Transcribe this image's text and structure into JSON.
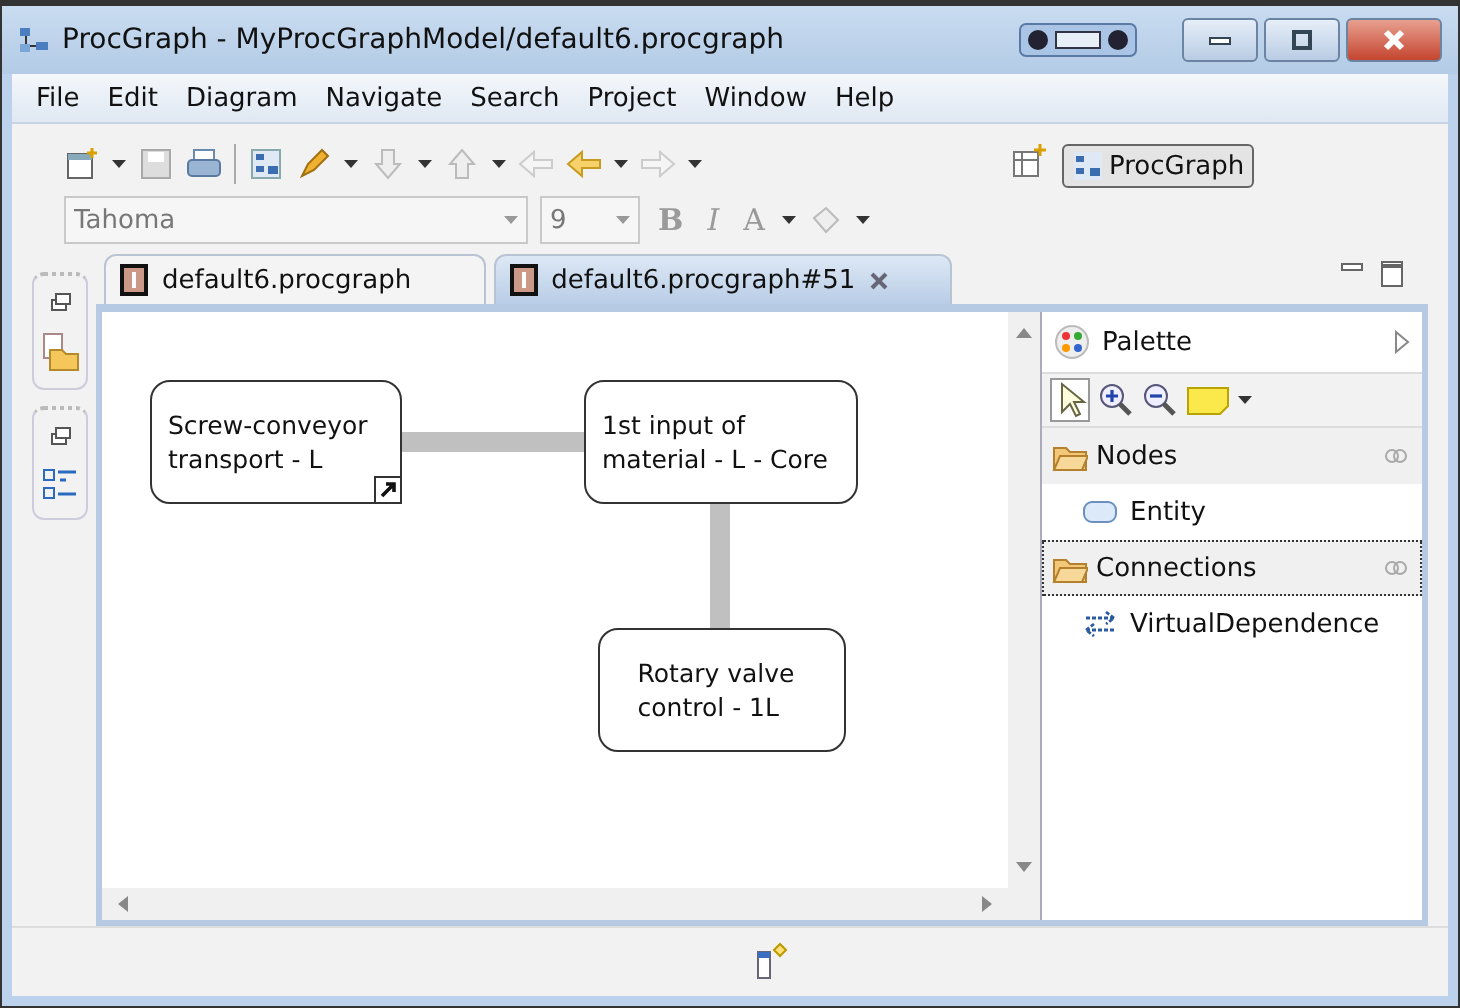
{
  "window": {
    "title": "ProcGraph - MyProcGraphModel/default6.procgraph"
  },
  "menu": [
    {
      "label": "File"
    },
    {
      "label": "Edit"
    },
    {
      "label": "Diagram"
    },
    {
      "label": "Navigate"
    },
    {
      "label": "Search"
    },
    {
      "label": "Project"
    },
    {
      "label": "Window"
    },
    {
      "label": "Help"
    }
  ],
  "toolbar": {
    "font": "Tahoma",
    "size": "9",
    "format_buttons": [
      {
        "label": "B",
        "disabled": true
      },
      {
        "label": "I",
        "disabled": true
      },
      {
        "label": "A",
        "disabled": true
      }
    ],
    "perspective": {
      "label": "ProcGraph",
      "selected": true
    }
  },
  "tabs": [
    {
      "label": "default6.procgraph",
      "selected": false,
      "closable": false
    },
    {
      "label": "default6.procgraph#51",
      "selected": true,
      "closable": true
    }
  ],
  "diagram": {
    "nodes": [
      {
        "label": "Screw-conveyor\ntransport - L",
        "shortcut": true
      },
      {
        "label": "1st input of\nmaterial - L - Core",
        "shortcut": false
      },
      {
        "label": "Rotary valve\ncontrol - 1L",
        "shortcut": false
      }
    ]
  },
  "palette": {
    "title": "Palette",
    "drawers": [
      {
        "label": "Nodes",
        "selected": false,
        "entries": [
          {
            "label": "Entity",
            "kind": "entity"
          }
        ]
      },
      {
        "label": "Connections",
        "selected": true,
        "entries": [
          {
            "label": "VirtualDependence",
            "kind": "connection"
          }
        ]
      }
    ]
  }
}
